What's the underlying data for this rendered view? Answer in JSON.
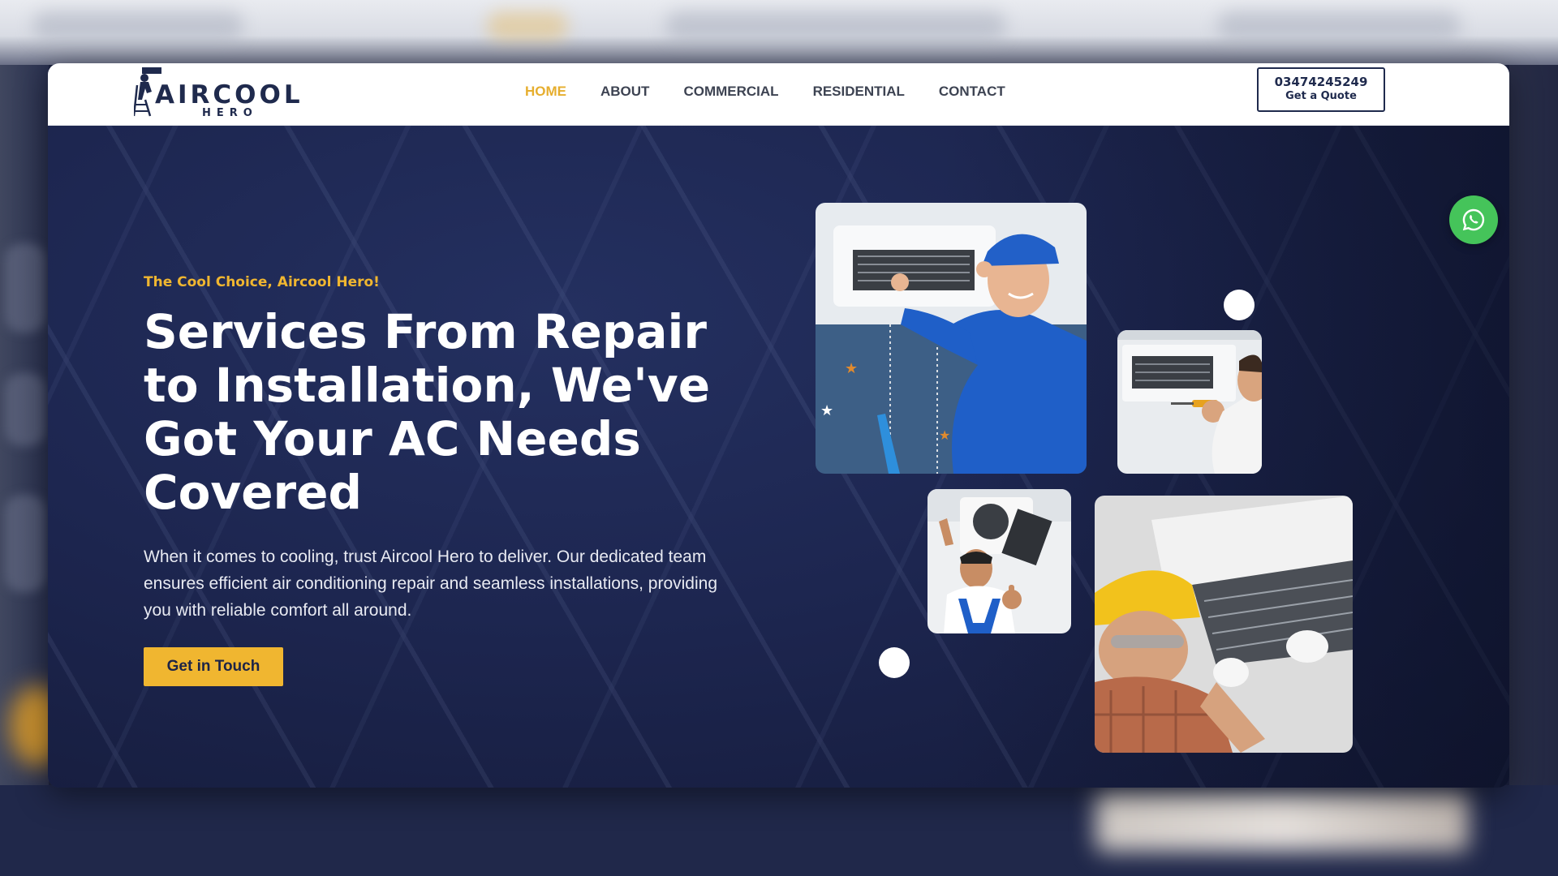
{
  "header": {
    "logo_main": "AIRCOOL",
    "logo_sub": "HERO",
    "nav": [
      {
        "label": "HOME",
        "active": true
      },
      {
        "label": "ABOUT",
        "active": false
      },
      {
        "label": "COMMERCIAL",
        "active": false
      },
      {
        "label": "RESIDENTIAL",
        "active": false
      },
      {
        "label": "CONTACT",
        "active": false
      }
    ],
    "cta": {
      "phone": "03474245249",
      "label": "Get a Quote"
    }
  },
  "hero": {
    "tagline": "The Cool Choice, Aircool Hero!",
    "headline": "Services From Repair to Installation, We've Got Your AC Needs Covered",
    "description": "When it comes to cooling, trust Aircool Hero to deliver. Our dedicated team ensures efficient air conditioning repair and seamless installations, providing you with reliable comfort all around.",
    "button_label": "Get in Touch"
  },
  "floating": {
    "icon": "whatsapp-icon"
  },
  "colors": {
    "accent": "#f0b630",
    "active_nav": "#e6ae2e",
    "navy": "#1f2a4d",
    "hero_bg": "#1d2650",
    "whatsapp": "#45c45a"
  }
}
